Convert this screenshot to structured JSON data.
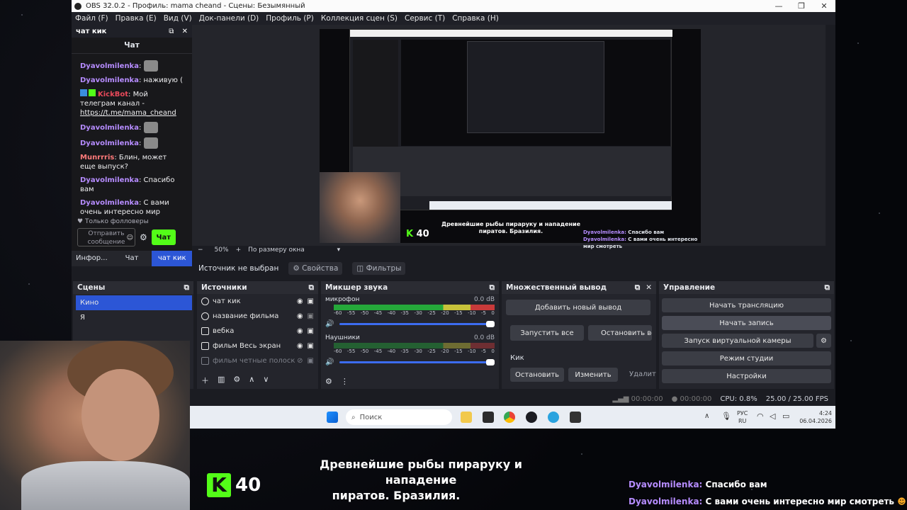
{
  "window": {
    "title": "OBS 32.0.2 - Профиль: mama cheand - Сцены: Безымянный",
    "minimize": "—",
    "maximize": "❐",
    "close": "✕"
  },
  "menu": [
    "Файл (F)",
    "Правка (E)",
    "Вид (V)",
    "Док-панели (D)",
    "Профиль (P)",
    "Коллекция сцен (S)",
    "Сервис (T)",
    "Справка (H)"
  ],
  "chat_dock": {
    "title": "чат кик",
    "header": "Чат",
    "messages": [
      {
        "user": "Dyavolmilenka",
        "sep": ":",
        "text": ""
      },
      {
        "user": "Dyavolmilenka",
        "sep": ":",
        "text": " наживую ("
      },
      {
        "user": "KickBot",
        "sep": ":",
        "text": " Мой телеграм канал -",
        "link": "https://t.me/mama_cheand"
      },
      {
        "user": "Dyavolmilenka",
        "sep": ":",
        "text": ""
      },
      {
        "user": "Dyavolmilenka",
        "sep": ":",
        "text": ""
      },
      {
        "user": "Munrrris",
        "sep": ":",
        "text": " Блин, может еще выпуск?"
      },
      {
        "user": "Dyavolmilenka",
        "sep": ":",
        "text": " Спасибо вам"
      },
      {
        "user": "Dyavolmilenka",
        "sep": ":",
        "text": " С вами очень интересно мир смотреть"
      }
    ],
    "followers_only": "Только фолловеры",
    "send_placeholder": "Отправить сообщение",
    "chat_button": "Чат",
    "tabs": [
      "Инфор...",
      "Чат",
      "чат кик"
    ]
  },
  "preview": {
    "zoom_minus": "−",
    "zoom": "50%",
    "zoom_plus": "+",
    "fit": "По размеру окна",
    "inner_caption_line1": "Древнейшие рыбы пираруку и нападение",
    "inner_caption_line2": "пиратов. Бразилия.",
    "inner_k": "40",
    "inner_chat1_user": "Dyavolmilenka:",
    "inner_chat1_text": " Спасибо вам",
    "inner_chat2_user": "Dyavolmilenka:",
    "inner_chat2_text": " С вами очень интересно мир смотреть"
  },
  "source_bar": {
    "no_source": "Источник не выбран",
    "properties": "Свойства",
    "filters": "Фильтры"
  },
  "scenes": {
    "title": "Сцены",
    "items": [
      "Кино",
      "Я"
    ]
  },
  "sources": {
    "title": "Источники",
    "items": [
      "чат кик",
      "название фильма",
      "вебка",
      "фильм Весь экран",
      "фильм четные полоск"
    ]
  },
  "mixer": {
    "title": "Микшер звука",
    "channels": [
      {
        "name": "микрофон",
        "db": "0.0 dB"
      },
      {
        "name": "Наушники",
        "db": "0.0 dB"
      }
    ],
    "scale": [
      "-60",
      "-55",
      "-50",
      "-45",
      "-40",
      "-35",
      "-30",
      "-25",
      "-20",
      "-15",
      "-10",
      "-5",
      "0"
    ]
  },
  "multi_output": {
    "title": "Множественный вывод",
    "add_button": "Добавить новый вывод",
    "start_all": "Запустить все",
    "stop_all": "Остановить все",
    "target_name": "Кик",
    "stop": "Остановить",
    "edit": "Изменить",
    "delete": "Удалит"
  },
  "controls": {
    "title": "Управление",
    "start_stream": "Начать трансляцию",
    "start_record": "Начать запись",
    "virtual_cam": "Запуск виртуальной камеры",
    "studio_mode": "Режим студии",
    "settings": "Настройки"
  },
  "statusbar": {
    "stream_time": "00:00:00",
    "record_time": "00:00:00",
    "cpu": "CPU: 0.8%",
    "fps": "25.00 / 25.00 FPS"
  },
  "taskbar": {
    "search": "Поиск",
    "lang1": "РУС",
    "lang2": "RU",
    "time": "4:24",
    "date": "06.04.2026"
  },
  "overlay": {
    "k_number": "40",
    "caption_line1": "Древнейшие рыбы пираруку и нападение",
    "caption_line2": "пиратов. Бразилия.",
    "chat1_user": "Dyavolmilenka:",
    "chat1_text": " Спасибо вам",
    "chat2_user": "Dyavolmilenka:",
    "chat2_text": " С вами очень интересно мир смотреть"
  },
  "colors": {
    "accent_blue": "#3c6cf0",
    "kick_green": "#53fc18",
    "username_purple": "#b68cff"
  }
}
